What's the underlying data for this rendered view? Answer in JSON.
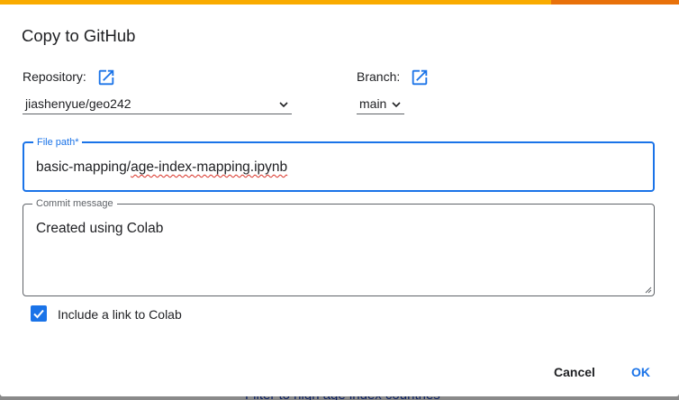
{
  "dialog": {
    "title": "Copy to GitHub",
    "accent_color": "#1a73e8",
    "topbar_colors": [
      "#f9ab00",
      "#e8710a"
    ]
  },
  "repository": {
    "label": "Repository:",
    "icon": "open-in-new-icon",
    "selected": "jiashenyue/geo242"
  },
  "branch": {
    "label": "Branch:",
    "icon": "open-in-new-icon",
    "selected": "main"
  },
  "file_path": {
    "label": "File path*",
    "value_prefix": "basic-mapping/",
    "value_misspelled": "age-index-mapping.ipynb"
  },
  "commit_message": {
    "label": "Commit message",
    "value": "Created using Colab"
  },
  "include_link": {
    "label": "Include a link to Colab",
    "checked": true
  },
  "actions": {
    "cancel_label": "Cancel",
    "ok_label": "OK"
  },
  "background": {
    "link_text": "Filter to high age index countries"
  }
}
